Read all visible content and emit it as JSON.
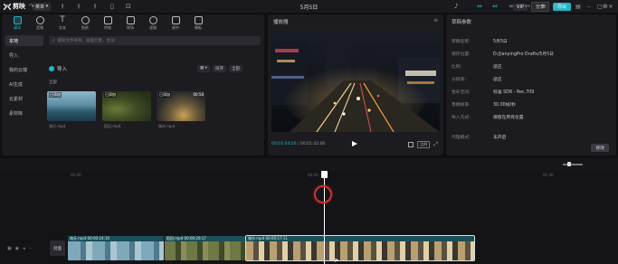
{
  "titlebar": {
    "app_name": "剪映",
    "menu_label": "菜单",
    "project_title": "5月5日",
    "vip_label": "VIP",
    "share_label": "分享",
    "export_label": "导出"
  },
  "media_panel": {
    "top_tabs": [
      {
        "label": "媒体"
      },
      {
        "label": "音频"
      },
      {
        "label": "文本"
      },
      {
        "label": "贴纸"
      },
      {
        "label": "特效"
      },
      {
        "label": "转场"
      },
      {
        "label": "滤镜"
      },
      {
        "label": "调节"
      },
      {
        "label": "模板"
      }
    ],
    "side_items": [
      "本地",
      "导入",
      "我的云端",
      "AI生成",
      "云素材",
      "素材库"
    ],
    "search_placeholder": "搜索文件名称、画面元素、台词",
    "import_label": "导入",
    "sort_label": "排序",
    "filter_label": "全部",
    "all_label": "全部",
    "clips": [
      {
        "tag": "已添加",
        "duration": "",
        "name": "海天.mp4"
      },
      {
        "tag": "已添加",
        "duration": "",
        "name": "稻田.mp4"
      },
      {
        "tag": "已添加",
        "duration": "00:58",
        "name": "城市.mp4"
      }
    ]
  },
  "player": {
    "title": "播放器",
    "current_time": "00:01:04:00",
    "total_time": "00:01:42:00",
    "ratio_label": "比例"
  },
  "draft": {
    "title": "草稿参数",
    "rows": [
      {
        "key": "草稿名称:",
        "value": "5月5日"
      },
      {
        "key": "保存位置:",
        "value": "D:/JianyingPro Drafts/5月5日"
      },
      {
        "key": "比例:",
        "value": "适应"
      },
      {
        "key": "分辨率:",
        "value": "适应"
      },
      {
        "key": "色彩空间:",
        "value": "标准 SDR - Rec.709"
      },
      {
        "key": "草稿帧率:",
        "value": "30.00帧/秒"
      },
      {
        "key": "导入方式:",
        "value": "保留在原有位置"
      },
      {
        "key": "代理模式:",
        "value": "未开启"
      }
    ],
    "modify_label": "修改"
  },
  "timeline": {
    "ruler_labels": [
      "00:00",
      "00:50",
      "01:40"
    ],
    "cover_label": "封面",
    "segments": [
      {
        "title": "海天.mp4  00:00:24:10"
      },
      {
        "title": "稻田.mp4  00:00:20:17"
      },
      {
        "title": "城市.mp4  00:00:57:11"
      }
    ]
  },
  "colors": {
    "accent": "#1fb6c8",
    "panel_bg": "#1c1c20",
    "app_bg": "#0f0f12",
    "segment_header": "#1b4e57",
    "cursor_ring": "#cc3333"
  }
}
